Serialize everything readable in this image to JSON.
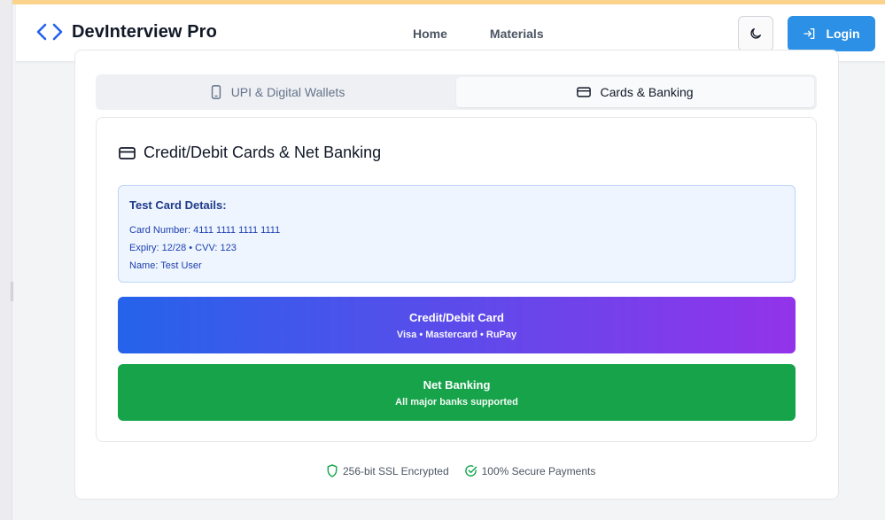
{
  "brand": {
    "name": "DevInterview Pro",
    "icon": "code-brackets-icon",
    "color": "#2563eb"
  },
  "nav": {
    "items": [
      {
        "label": "Home"
      },
      {
        "label": "Materials"
      }
    ]
  },
  "header": {
    "theme_icon": "moon-icon",
    "login_label": "Login",
    "login_icon": "login-arrow-icon",
    "accent": "#2b90e6",
    "stripe_color": "#fbd38d"
  },
  "tabs": [
    {
      "label": "UPI & Digital Wallets",
      "icon": "smartphone-icon",
      "active": false
    },
    {
      "label": "Cards & Banking",
      "icon": "credit-card-icon",
      "active": true
    }
  ],
  "section": {
    "title": "Credit/Debit Cards & Net Banking",
    "icon": "credit-card-icon",
    "test_card": {
      "title": "Test Card Details:",
      "lines": [
        "Card Number: 4111 1111 1111 1111",
        "Expiry: 12/28 • CVV: 123",
        "Name: Test User"
      ]
    },
    "options": [
      {
        "title": "Credit/Debit Card",
        "subtitle": "Visa • Mastercard • RuPay",
        "colors": [
          "#2563eb",
          "#9333ea"
        ]
      },
      {
        "title": "Net Banking",
        "subtitle": "All major banks supported",
        "colors": [
          "#16a34a"
        ]
      }
    ]
  },
  "footer": {
    "badges": [
      {
        "label": "256-bit SSL Encrypted",
        "icon": "shield-icon"
      },
      {
        "label": "100% Secure Payments",
        "icon": "check-circle-icon"
      }
    ],
    "icon_color": "#16a34a"
  }
}
